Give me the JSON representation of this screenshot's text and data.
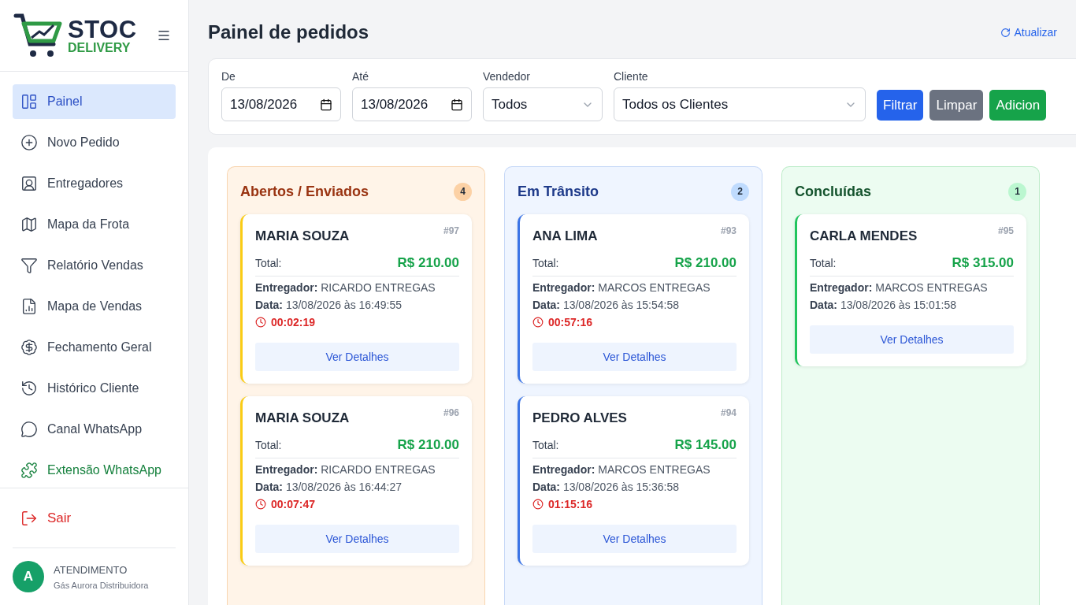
{
  "brand": {
    "name": "STOC",
    "tagline": "DELIVERY"
  },
  "sidebar": {
    "items": [
      {
        "label": "Painel",
        "selected": true,
        "kind": "normal"
      },
      {
        "label": "Novo Pedido",
        "selected": false,
        "kind": "normal"
      },
      {
        "label": "Entregadores",
        "selected": false,
        "kind": "normal"
      },
      {
        "label": "Mapa da Frota",
        "selected": false,
        "kind": "normal"
      },
      {
        "label": "Relatório Vendas",
        "selected": false,
        "kind": "normal"
      },
      {
        "label": "Mapa de Vendas",
        "selected": false,
        "kind": "normal"
      },
      {
        "label": "Fechamento Geral",
        "selected": false,
        "kind": "normal"
      },
      {
        "label": "Histórico Cliente",
        "selected": false,
        "kind": "normal"
      },
      {
        "label": "Canal WhatsApp",
        "selected": false,
        "kind": "normal"
      },
      {
        "label": "Extensão WhatsApp",
        "selected": false,
        "kind": "accent"
      }
    ],
    "logout": "Sair",
    "user": {
      "initial": "A",
      "role": "ATENDIMENTO",
      "company": "Gás Aurora Distribuidora"
    }
  },
  "page": {
    "title": "Painel de pedidos",
    "refresh": "Atualizar"
  },
  "filters": {
    "from": {
      "label": "De",
      "value": "13/08/2026"
    },
    "to": {
      "label": "Até",
      "value": "13/08/2026"
    },
    "seller": {
      "label": "Vendedor",
      "value": "Todos"
    },
    "client": {
      "label": "Cliente",
      "value": "Todos os Clientes"
    },
    "buttons": [
      {
        "label": "Filtrar",
        "kind": "primary"
      },
      {
        "label": "Limpar",
        "kind": "secondary"
      },
      {
        "label": "Adicion",
        "kind": "success"
      }
    ]
  },
  "columns": [
    {
      "title": "Abertos / Enviados",
      "count": "4",
      "kind": "open",
      "orders": [
        {
          "customer": "MARIA SOUZA",
          "id": "#97",
          "total_label": "Total:",
          "total": "R$ 210.00",
          "courier_label": "Entregador:",
          "courier": "RICARDO ENTREGAS",
          "date_label": "Data:",
          "date": "13/08/2026 às 16:49:55",
          "timer": "00:02:19",
          "action": "Ver Detalhes"
        },
        {
          "customer": "MARIA SOUZA",
          "id": "#96",
          "total_label": "Total:",
          "total": "R$ 210.00",
          "courier_label": "Entregador:",
          "courier": "RICARDO ENTREGAS",
          "date_label": "Data:",
          "date": "13/08/2026 às 16:44:27",
          "timer": "00:07:47",
          "action": "Ver Detalhes"
        }
      ]
    },
    {
      "title": "Em Trânsito",
      "count": "2",
      "kind": "transit",
      "orders": [
        {
          "customer": "ANA LIMA",
          "id": "#93",
          "total_label": "Total:",
          "total": "R$ 210.00",
          "courier_label": "Entregador:",
          "courier": "MARCOS ENTREGAS",
          "date_label": "Data:",
          "date": "13/08/2026 às 15:54:58",
          "timer": "00:57:16",
          "action": "Ver Detalhes"
        },
        {
          "customer": "PEDRO ALVES",
          "id": "#94",
          "total_label": "Total:",
          "total": "R$ 145.00",
          "courier_label": "Entregador:",
          "courier": "MARCOS ENTREGAS",
          "date_label": "Data:",
          "date": "13/08/2026 às 15:36:58",
          "timer": "01:15:16",
          "action": "Ver Detalhes"
        }
      ]
    },
    {
      "title": "Concluídas",
      "count": "1",
      "kind": "done",
      "orders": [
        {
          "customer": "CARLA MENDES",
          "id": "#95",
          "total_label": "Total:",
          "total": "R$ 315.00",
          "courier_label": "Entregador:",
          "courier": "MARCOS ENTREGAS",
          "date_label": "Data:",
          "date": "13/08/2026 às 15:01:58",
          "action": "Ver Detalhes"
        }
      ]
    }
  ]
}
